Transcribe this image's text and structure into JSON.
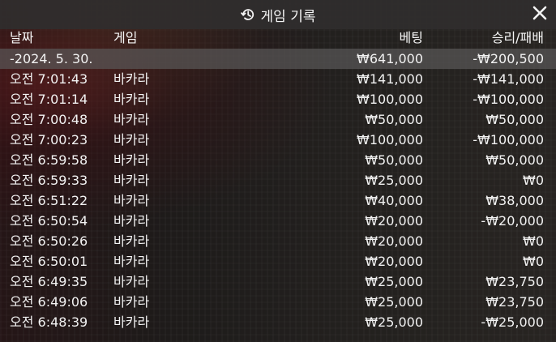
{
  "header": {
    "title": "게임 기록",
    "icon": "history-icon",
    "close_icon": "close-icon"
  },
  "columns": {
    "date": "날짜",
    "game": "게임",
    "bet": "베팅",
    "result": "승리/패배"
  },
  "summary": {
    "date": "-2024. 5. 30.",
    "game": "",
    "bet": "₩641,000",
    "result": "-₩200,500"
  },
  "rows": [
    {
      "time": "오전 7:01:43",
      "game": "바카라",
      "bet": "₩141,000",
      "result": "-₩141,000"
    },
    {
      "time": "오전 7:01:14",
      "game": "바카라",
      "bet": "₩100,000",
      "result": "-₩100,000"
    },
    {
      "time": "오전 7:00:48",
      "game": "바카라",
      "bet": "₩50,000",
      "result": "₩50,000"
    },
    {
      "time": "오전 7:00:23",
      "game": "바카라",
      "bet": "₩100,000",
      "result": "-₩100,000"
    },
    {
      "time": "오전 6:59:58",
      "game": "바카라",
      "bet": "₩50,000",
      "result": "₩50,000"
    },
    {
      "time": "오전 6:59:33",
      "game": "바카라",
      "bet": "₩25,000",
      "result": "₩0"
    },
    {
      "time": "오전 6:51:22",
      "game": "바카라",
      "bet": "₩40,000",
      "result": "₩38,000"
    },
    {
      "time": "오전 6:50:54",
      "game": "바카라",
      "bet": "₩20,000",
      "result": "-₩20,000"
    },
    {
      "time": "오전 6:50:26",
      "game": "바카라",
      "bet": "₩20,000",
      "result": "₩0"
    },
    {
      "time": "오전 6:50:01",
      "game": "바카라",
      "bet": "₩20,000",
      "result": "₩0"
    },
    {
      "time": "오전 6:49:35",
      "game": "바카라",
      "bet": "₩25,000",
      "result": "₩23,750"
    },
    {
      "time": "오전 6:49:06",
      "game": "바카라",
      "bet": "₩25,000",
      "result": "₩23,750"
    },
    {
      "time": "오전 6:48:39",
      "game": "바카라",
      "bet": "₩25,000",
      "result": "-₩25,000"
    }
  ]
}
